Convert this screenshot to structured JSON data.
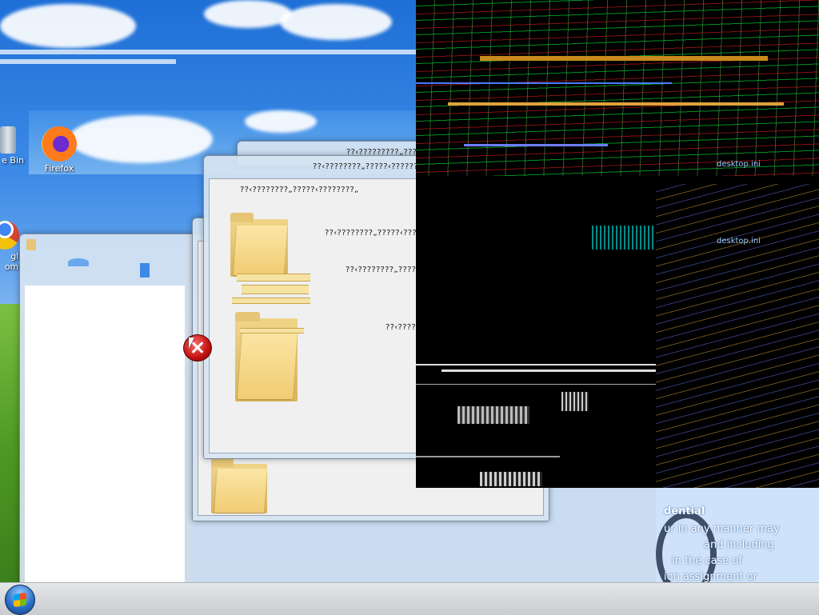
{
  "desktop": {
    "icons": [
      {
        "id": "recycle-bin",
        "label": "e Bin",
        "icon": "recycle-bin-icon"
      },
      {
        "id": "firefox",
        "label": "Firefox",
        "icon": "firefox-icon"
      },
      {
        "id": "chrome",
        "label": "gle",
        "label2": "ome",
        "icon": "chrome-icon"
      }
    ]
  },
  "windows": {
    "back_title": "??‹?????????„?????‹?????????",
    "front_title": "??‹????????„?????‹????????„",
    "dialog_lines": [
      "??‹????????„?????‹????????„",
      "??‹????????„?????‹????????„",
      "??‹????????„?????‹????????„",
      "??‹????????„?????‹????????„"
    ]
  },
  "glitch_labels": {
    "a": "desktop.ini",
    "b": "desktop.ini"
  },
  "confidential": {
    "title": "dential",
    "lines": [
      "ur in any manner may",
      "and including",
      "in the case of",
      "ion assignment or"
    ]
  },
  "taskbar": {
    "start_icon": "windows-start-orb"
  },
  "colors": {
    "accent": "#2a6fc9",
    "error": "#c01010",
    "folder": "#f1cc73"
  }
}
